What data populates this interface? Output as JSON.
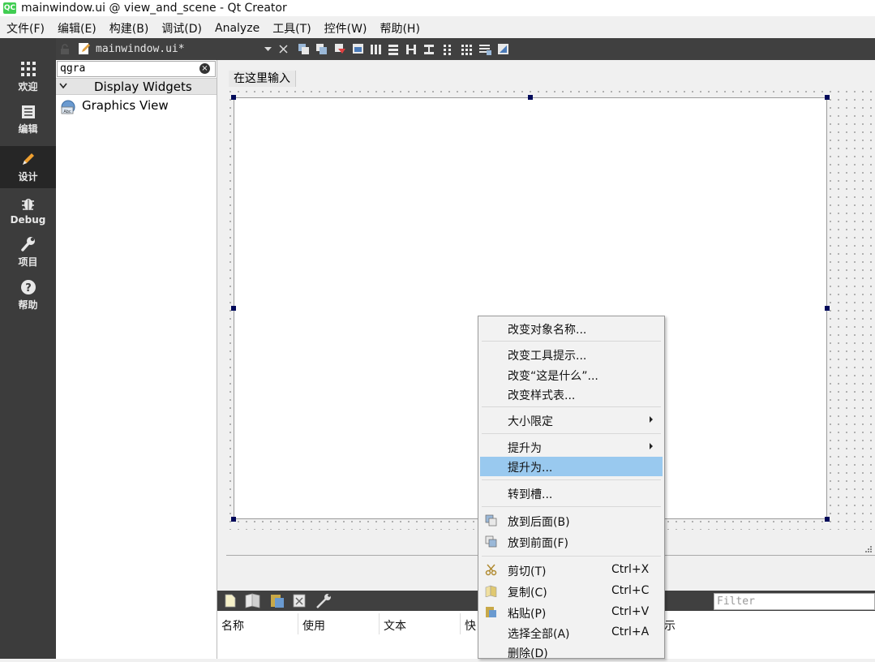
{
  "window": {
    "title": "mainwindow.ui @ view_and_scene - Qt Creator",
    "icon": "qt-logo-icon"
  },
  "menubar": {
    "items": [
      "文件(F)",
      "编辑(E)",
      "构建(B)",
      "调试(D)",
      "Analyze",
      "工具(T)",
      "控件(W)",
      "帮助(H)"
    ]
  },
  "modes": [
    {
      "label": "欢迎",
      "icon": "grid-icon",
      "active": false
    },
    {
      "label": "编辑",
      "icon": "document-icon",
      "active": false
    },
    {
      "label": "设计",
      "icon": "pencil-icon",
      "active": true
    },
    {
      "label": "Debug",
      "icon": "bug-icon",
      "active": false
    },
    {
      "label": "项目",
      "icon": "wrench-icon",
      "active": false
    },
    {
      "label": "帮助",
      "icon": "help-icon",
      "active": false
    }
  ],
  "editor": {
    "document": "mainwindow.ui*"
  },
  "widget_box": {
    "filter_value": "qgra",
    "category": "Display Widgets",
    "items": [
      {
        "label": "Graphics View",
        "icon": "graphics-view-icon"
      }
    ]
  },
  "form": {
    "menu_placeholder": "在这里输入"
  },
  "action_editor": {
    "filter_placeholder": "Filter",
    "columns": [
      "名称",
      "使用",
      "文本",
      "快",
      "示"
    ]
  },
  "context_menu": {
    "items": [
      {
        "label": "改变对象名称..."
      },
      {
        "label": "改变工具提示..."
      },
      {
        "label": "改变“这是什么”..."
      },
      {
        "label": "改变样式表..."
      },
      {
        "label": "大小限定",
        "submenu": true
      },
      {
        "label": "提升为",
        "submenu": true
      },
      {
        "label": "提升为...",
        "highlighted": true
      },
      {
        "label": "转到槽..."
      },
      {
        "label": "放到后面(B)",
        "icon": "send-to-back-icon"
      },
      {
        "label": "放到前面(F)",
        "icon": "bring-to-front-icon"
      },
      {
        "label": "剪切(T)",
        "shortcut": "Ctrl+X",
        "icon": "cut-icon"
      },
      {
        "label": "复制(C)",
        "shortcut": "Ctrl+C",
        "icon": "copy-icon"
      },
      {
        "label": "粘贴(P)",
        "shortcut": "Ctrl+V",
        "icon": "paste-icon"
      },
      {
        "label": "选择全部(A)",
        "shortcut": "Ctrl+A"
      },
      {
        "label": "删除(D)"
      }
    ]
  },
  "colors": {
    "mode_bar": "#3c3c3c",
    "toolbar": "#404040",
    "highlight": "#99c9ef",
    "handle": "#000a5a"
  }
}
